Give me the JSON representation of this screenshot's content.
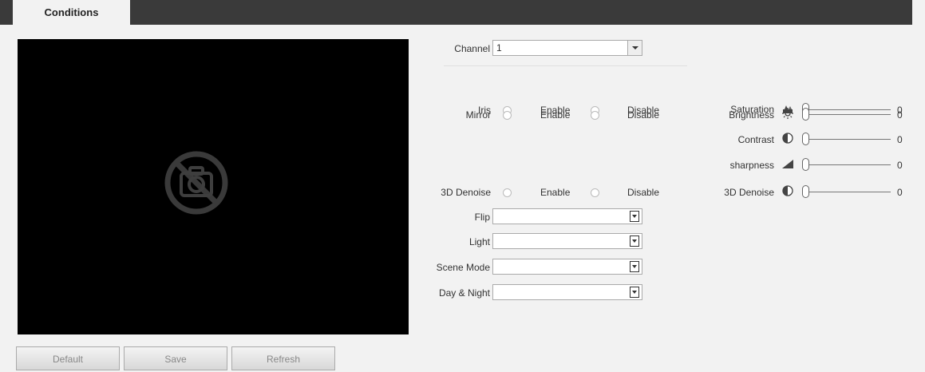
{
  "tab": {
    "label": "Conditions"
  },
  "buttons": {
    "default": "Default",
    "save": "Save",
    "refresh": "Refresh"
  },
  "channel": {
    "label": "Channel",
    "value": "1"
  },
  "radio_rows": [
    {
      "label": "Iris",
      "enable": "Enable",
      "disable": "Disable"
    },
    {
      "label": "Mirror",
      "enable": "Enable",
      "disable": "Disable"
    },
    {
      "label": "3D Denoise",
      "enable": "Enable",
      "disable": "Disable"
    }
  ],
  "selects": [
    {
      "label": "Flip",
      "value": ""
    },
    {
      "label": "Light",
      "value": ""
    },
    {
      "label": "Scene Mode",
      "value": ""
    },
    {
      "label": "Day & Night",
      "value": ""
    }
  ],
  "sliders": [
    {
      "label": "Saturation",
      "icon": "saturation-icon",
      "value": "0"
    },
    {
      "label": "Brightness",
      "icon": "brightness-icon",
      "value": "0"
    },
    {
      "label": "Contrast",
      "icon": "contrast-icon",
      "value": "0"
    },
    {
      "label": "sharpness",
      "icon": "sharpness-icon",
      "value": "0"
    },
    {
      "label": "3D Denoise",
      "icon": "denoise-icon",
      "value": "0"
    }
  ]
}
